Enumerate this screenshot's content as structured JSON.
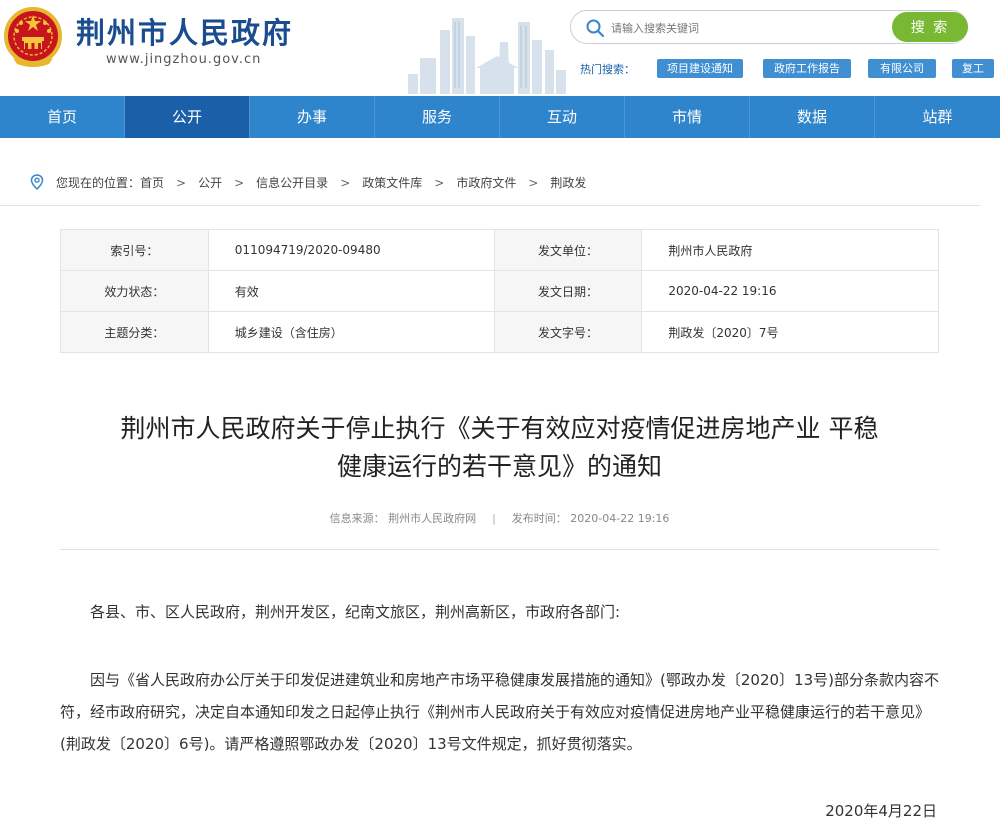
{
  "header": {
    "site_title": "荆州市人民政府",
    "site_url": "www.jingzhou.gov.cn",
    "search_placeholder": "请输入搜索关键词",
    "search_button": "搜 索",
    "hot_label": "热门搜索：",
    "hot_tags": [
      "项目建设通知",
      "政府工作报告",
      "有限公司",
      "复工"
    ]
  },
  "nav": {
    "items": [
      "首页",
      "公开",
      "办事",
      "服务",
      "互动",
      "市情",
      "数据",
      "站群"
    ],
    "active_index": 1
  },
  "breadcrumb": {
    "prefix": "您现在的位置：",
    "items": [
      "首页",
      "公开",
      "信息公开目录",
      "政策文件库",
      "市政府文件",
      "荆政发"
    ],
    "separator": ">"
  },
  "info": {
    "rows": [
      {
        "l1": "索引号：",
        "v1": "011094719/2020-09480",
        "l2": "发文单位：",
        "v2": "荆州市人民政府"
      },
      {
        "l1": "效力状态：",
        "v1": "有效",
        "l2": "发文日期：",
        "v2": "2020-04-22 19:16"
      },
      {
        "l1": "主题分类：",
        "v1": "城乡建设（含住房）",
        "l2": "发文字号：",
        "v2": "荆政发〔2020〕7号"
      }
    ]
  },
  "article": {
    "title_line1": "荆州市人民政府关于停止执行《关于有效应对疫情促进房地产业 平稳",
    "title_line2": "健康运行的若干意见》的通知",
    "source": "信息来源： 荆州市人民政府网",
    "meta_sep": "|",
    "publish_time": "发布时间： 2020-04-22 19:16",
    "greeting": "各县、市、区人民政府，荆州开发区，纪南文旅区，荆州高新区，市政府各部门:",
    "body": "因与《省人民政府办公厅关于印发促进建筑业和房地产市场平稳健康发展措施的通知》(鄂政办发〔2020〕13号)部分条款内容不符，经市政府研究，决定自本通知印发之日起停止执行《荆州市人民政府关于有效应对疫情促进房地产业平稳健康运行的若干意见》(荆政发〔2020〕6号)。请严格遵照鄂政办发〔2020〕13号文件规定，抓好贯彻落实。",
    "date": "2020年4月22日"
  },
  "colors": {
    "nav_bg": "#2f85cc",
    "nav_active": "#1a5fa8",
    "search_button": "#78b833",
    "title_blue": "#1a4d8f",
    "hot_tag": "#3f8fd2"
  }
}
